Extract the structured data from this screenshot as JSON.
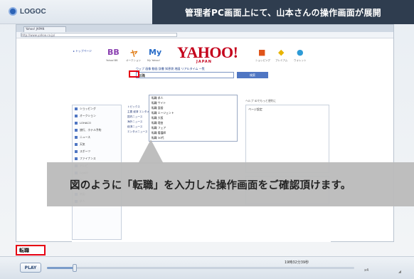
{
  "app": {
    "name": "LOGOC"
  },
  "banner": {
    "text": "管理者PC画面上にて、山本さんの操作画面が展開"
  },
  "browser": {
    "tab_label": "Yahoo! JAPAN",
    "address": "http://www.yahoo.co.jp/"
  },
  "yahoo": {
    "logo": "YAHOO!",
    "logo_sub": "JAPAN",
    "header_icons": [
      {
        "label": "BB",
        "caption": "Yahoo!BB",
        "color": "#8a3fb0"
      },
      {
        "label": "ヤ",
        "caption": "オークション",
        "color": "#e07a12"
      },
      {
        "label": "My",
        "caption": "My Yahoo!",
        "color": "#2a6ec9"
      },
      {
        "label": "■",
        "caption": "ショッピング",
        "color": "#e0541a"
      },
      {
        "label": "◆",
        "caption": "プレミアム",
        "color": "#e8b400"
      },
      {
        "label": "●",
        "caption": "ウォレット",
        "color": "#2e9bd6"
      }
    ],
    "nav_tabs": "ウェブ  画像  動画  辞書  知恵袋  地図  リアルタイム  一覧",
    "search_typed": "転職",
    "search_button": "検索",
    "suggestions": [
      "転職 求人",
      "転職 サイト",
      "転職 面接",
      "転職 エージェント",
      "転職 大阪",
      "転職 理由",
      "転職 フェア",
      "転職 看護師",
      "転職 30代"
    ],
    "left_nav": [
      "ショッピング",
      "オークション",
      "LOHACO",
      "旅行、ホテル予約",
      "ニュース",
      "天気",
      "スポーツ",
      "ファイナンス",
      "テレビ",
      "GyaO!",
      "ゲーム",
      "ブログ",
      "地図",
      "求人"
    ],
    "news_lines": [
      "トピックス",
      "主要  経済  エンタメ  スポーツ",
      "国内ニュース",
      "海外ニュース",
      "経済ニュース",
      "エンタメニュース"
    ],
    "right_head": "ヘルプ  IDでもっと便利に",
    "right_box_title": "ページ設定",
    "login_label": "ログイン"
  },
  "overlay": {
    "caption": "図のように「転職」を入力した操作画面をご確認頂けます。"
  },
  "keystroke": {
    "text": "転職"
  },
  "player": {
    "play_label": "PLAY",
    "time": "19時32分39秒",
    "speed": "x4",
    "progress": 0.09
  }
}
